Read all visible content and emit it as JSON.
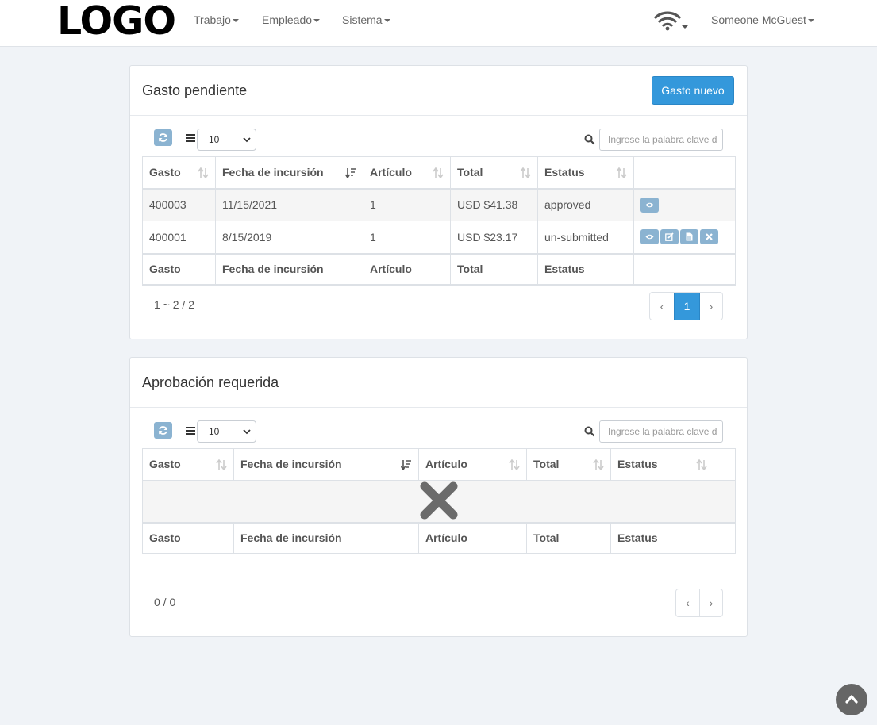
{
  "brand": {
    "logo": "LOGO"
  },
  "nav": {
    "menus": [
      "Trabajo",
      "Empleado",
      "Sistema"
    ],
    "user": "Someone McGuest"
  },
  "pending": {
    "title": "Gasto pendiente",
    "new_button": "Gasto nuevo",
    "page_size": "10",
    "search_placeholder": "Ingrese la palabra clave d",
    "columns": [
      "Gasto",
      "Fecha de incursión",
      "Artículo",
      "Total",
      "Estatus"
    ],
    "rows": [
      {
        "id": "400003",
        "date": "11/15/2021",
        "items": "1",
        "total": "USD $41.38",
        "status": "approved",
        "actions": [
          "view-icon"
        ]
      },
      {
        "id": "400001",
        "date": "8/15/2019",
        "items": "1",
        "total": "USD $23.17",
        "status": "un-submitted",
        "actions": [
          "view-icon",
          "edit-icon",
          "document-icon",
          "delete-icon"
        ]
      }
    ],
    "info": "1 ~ 2 / 2",
    "pagination": {
      "prev": "‹",
      "current": "1",
      "next": "›"
    }
  },
  "approval": {
    "title": "Aprobación requerida",
    "page_size": "10",
    "search_placeholder": "Ingrese la palabra clave d",
    "columns": [
      "Gasto",
      "Fecha de incursión",
      "Artículo",
      "Total",
      "Estatus"
    ],
    "empty_icon": "no-data-x-icon",
    "info": "0 / 0",
    "pagination": {
      "prev": "‹",
      "next": "›"
    }
  },
  "colors": {
    "primary": "#3498db",
    "action": "#8bb3d1",
    "background": "#f0f3f7"
  }
}
